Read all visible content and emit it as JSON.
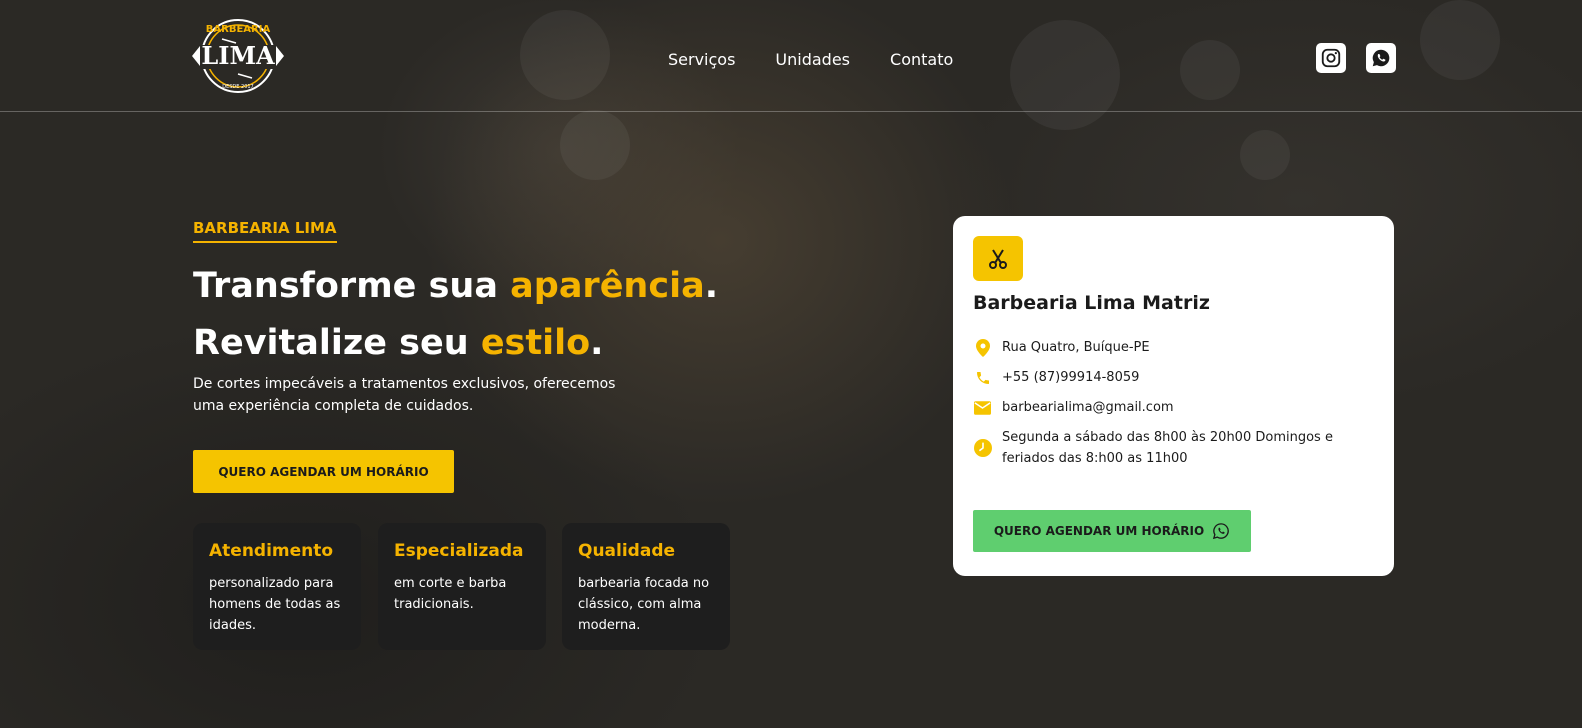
{
  "brand": {
    "logo_top": "BARBEARIA",
    "logo_main": "LIMA",
    "logo_bottom": "DESDE 2017",
    "accent_color": "#f5c400",
    "whatsapp_color": "#5fce6f"
  },
  "nav": {
    "items": [
      {
        "label": "Serviços"
      },
      {
        "label": "Unidades"
      },
      {
        "label": "Contato"
      }
    ]
  },
  "social": {
    "icons": [
      "instagram-icon",
      "whatsapp-icon"
    ]
  },
  "hero": {
    "eyebrow": "BARBEARIA LIMA",
    "line1_a": "Transforme sua ",
    "line1_accent": "aparência",
    "line1_end": ".",
    "line2_a": "Revitalize seu ",
    "line2_accent": "estilo",
    "line2_end": ".",
    "lead": "De cortes impecáveis a tratamentos exclusivos, oferecemos uma experiência completa de cuidados.",
    "cta_label": "QUERO AGENDAR UM HORÁRIO"
  },
  "features": [
    {
      "title": "Atendimento",
      "text": "personalizado para homens de todas as idades."
    },
    {
      "title": "Especializada",
      "text": "em corte e barba tradicionais."
    },
    {
      "title": "Qualidade",
      "text": "barbearia focada no clássico, com alma moderna."
    }
  ],
  "card": {
    "title": "Barbearia Lima Matriz",
    "address": "Rua Quatro, Buíque-PE",
    "phone": "+55 (87)99914-8059",
    "email": "barbearialima@gmail.com",
    "hours": "Segunda a sábado das 8h00 às 20h00 Domingos e feriados das 8:h00 as 11h00",
    "button_label": "QUERO AGENDAR UM HORÁRIO"
  }
}
